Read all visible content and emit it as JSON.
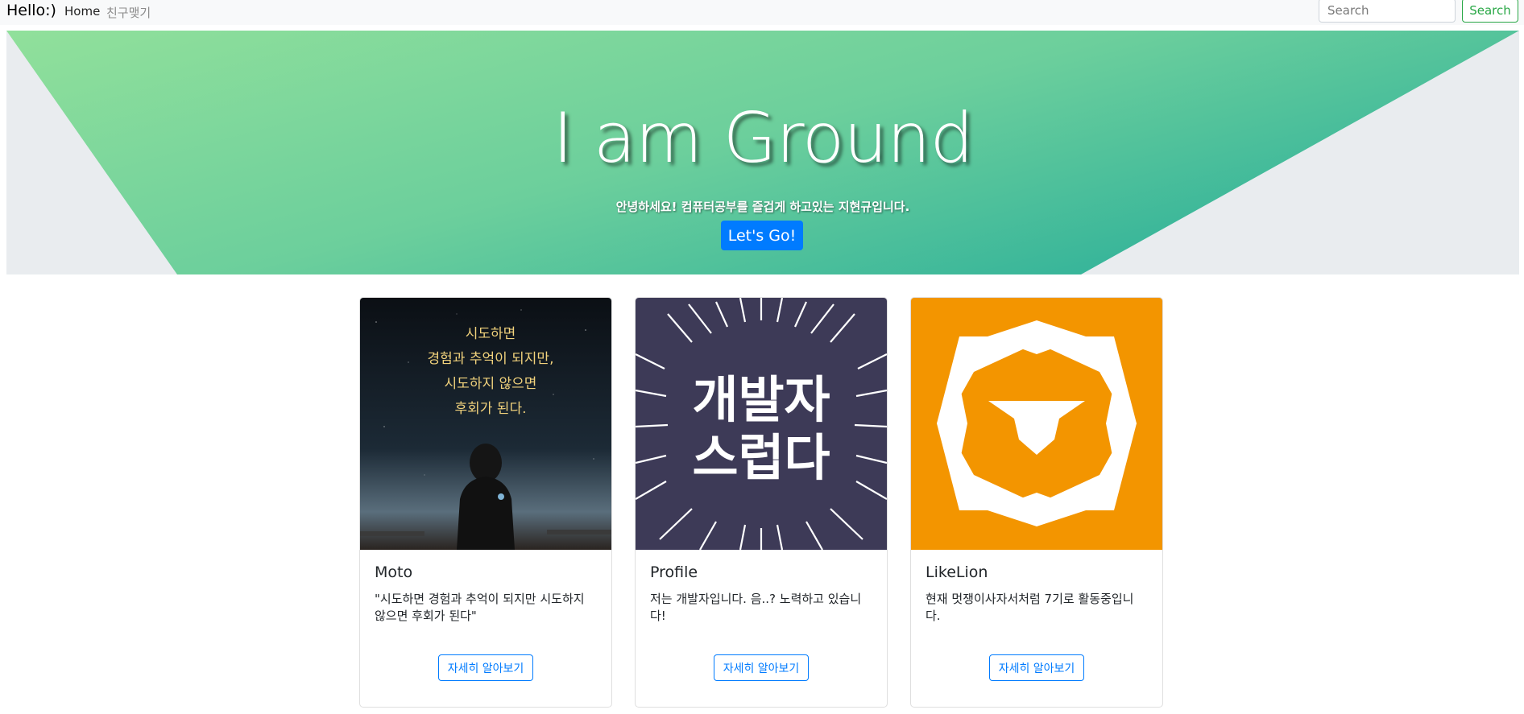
{
  "navbar": {
    "brand": "Hello:)",
    "links": [
      "Home",
      "친구맺기"
    ],
    "search_placeholder": "Search",
    "search_button": "Search"
  },
  "hero": {
    "title": "I am Ground",
    "subtitle": "안녕하세요! 컴퓨터공부를 즐겁게 하고있는 지현규입니다.",
    "button": "Let's Go!"
  },
  "cards": [
    {
      "image_text": [
        "시도하면",
        "경험과 추억이 되지만,",
        "시도하지 않으면",
        "후회가 된다."
      ],
      "title": "Moto",
      "text": "\"시도하면 경험과 추억이 되지만 시도하지 않으면 후회가 된다\"",
      "button": "자세히 알아보기"
    },
    {
      "image_text": [
        "개발자",
        "스럽다"
      ],
      "title": "Profile",
      "text": "저는 개발자입니다. 음..? 노력하고 있습니다!",
      "button": "자세히 알아보기"
    },
    {
      "image_text": [],
      "title": "LikeLion",
      "text": "현재 멋쟁이사자서처럼 7기로 활동중입니다.",
      "button": "자세히 알아보기"
    }
  ],
  "colors": {
    "hero_gradient_start": "#8fe09c",
    "hero_gradient_end": "#36b59a",
    "primary": "#007bff",
    "success": "#28a745",
    "lion_orange": "#f39500",
    "profile_bg": "#3d3a57"
  },
  "icons": [
    "lion-logo-icon"
  ]
}
